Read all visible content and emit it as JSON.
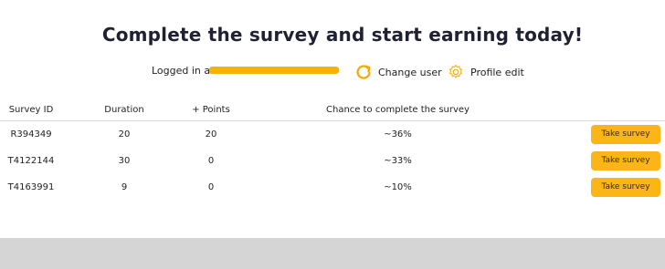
{
  "headline": "Complete the survey and start earning today!",
  "user": {
    "logged_in_label": "Logged in as:",
    "change_user_label": "Change user",
    "profile_edit_label": "Profile edit"
  },
  "table": {
    "headers": [
      "Survey ID",
      "Duration",
      "+ Points",
      "Chance to complete the survey",
      ""
    ],
    "rows": [
      {
        "id": "R394349",
        "duration": "20",
        "points": "20",
        "chance": "~36%",
        "action": "Take survey"
      },
      {
        "id": "T4122144",
        "duration": "30",
        "points": "0",
        "chance": "~33%",
        "action": "Take survey"
      },
      {
        "id": "T4163991",
        "duration": "9",
        "points": "0",
        "chance": "~10%",
        "action": "Take survey"
      }
    ]
  },
  "colors": {
    "accent": "#fbb516",
    "heading": "#1f2133",
    "footer": "#d5d5d5"
  },
  "icons": {
    "change_user": "refresh-icon",
    "profile_edit": "gear-icon"
  }
}
